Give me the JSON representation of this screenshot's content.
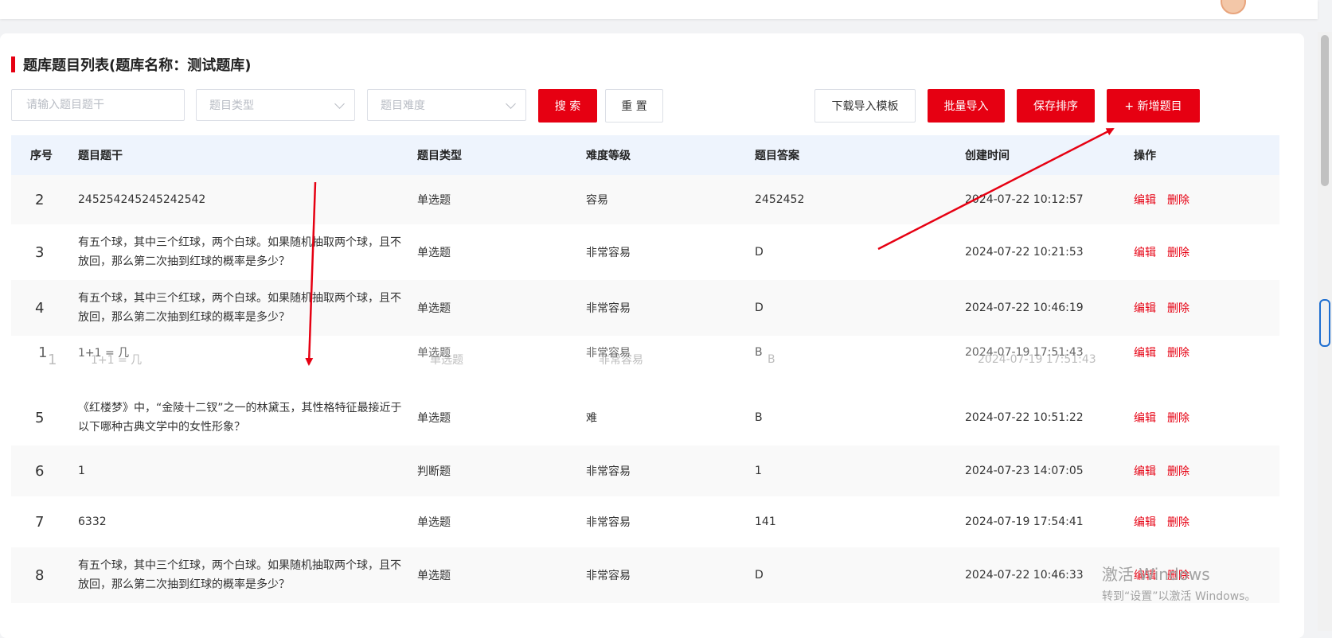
{
  "title": "题库题目列表(题库名称：测试题库)",
  "filters": {
    "stem_placeholder": "请输入题目题干",
    "type_placeholder": "题目类型",
    "difficulty_placeholder": "题目难度"
  },
  "buttons": {
    "search": "搜 索",
    "reset": "重 置",
    "download_template": "下载导入模板",
    "batch_import": "批量导入",
    "save_order": "保存排序",
    "add_question": "+ 新增题目"
  },
  "table": {
    "headers": [
      "序号",
      "题目题干",
      "题目类型",
      "难度等级",
      "题目答案",
      "创建时间",
      "操作"
    ],
    "rows": [
      {
        "idx": "2",
        "stem": "245254245245242542",
        "type": "单选题",
        "difficulty": "容易",
        "answer": "2452452",
        "created": "2024-07-22 10:12:57"
      },
      {
        "idx": "3",
        "stem": "有五个球，其中三个红球，两个白球。如果随机抽取两个球，且不放回，那么第二次抽到红球的概率是多少？",
        "type": "单选题",
        "difficulty": "非常容易",
        "answer": "D",
        "created": "2024-07-22 10:21:53"
      },
      {
        "idx": "4",
        "stem": "有五个球，其中三个红球，两个白球。如果随机抽取两个球，且不放回，那么第二次抽到红球的概率是多少？",
        "type": "单选题",
        "difficulty": "非常容易",
        "answer": "D",
        "created": "2024-07-22 10:46:19"
      },
      {
        "idx": "5",
        "stem": "《红楼梦》中，“金陵十二钗”之一的林黛玉，其性格特征最接近于以下哪种古典文学中的女性形象？",
        "type": "单选题",
        "difficulty": "难",
        "answer": "B",
        "created": "2024-07-22 10:51:22"
      },
      {
        "idx": "6",
        "stem": "1",
        "type": "判断题",
        "difficulty": "非常容易",
        "answer": "1",
        "created": "2024-07-23 14:07:05"
      },
      {
        "idx": "7",
        "stem": "6332",
        "type": "单选题",
        "difficulty": "非常容易",
        "answer": "141",
        "created": "2024-07-19 17:54:41"
      },
      {
        "idx": "8",
        "stem": "有五个球，其中三个红球，两个白球。如果随机抽取两个球，且不放回，那么第二次抽到红球的概率是多少？",
        "type": "单选题",
        "difficulty": "非常容易",
        "answer": "D",
        "created": "2024-07-22 10:46:33"
      }
    ],
    "dragging_row": {
      "idx": "1",
      "stem": "1+1 = 几",
      "type": "单选题",
      "difficulty": "非常容易",
      "answer": "B",
      "created": "2024-07-19 17:51:43"
    },
    "edit_label": "编辑",
    "delete_label": "删除"
  },
  "watermark": {
    "line1": "激活 Windows",
    "line2": "转到“设置”以激活 Windows。"
  },
  "colors": {
    "accent": "#e60012",
    "header_bg": "#eef4fd"
  }
}
